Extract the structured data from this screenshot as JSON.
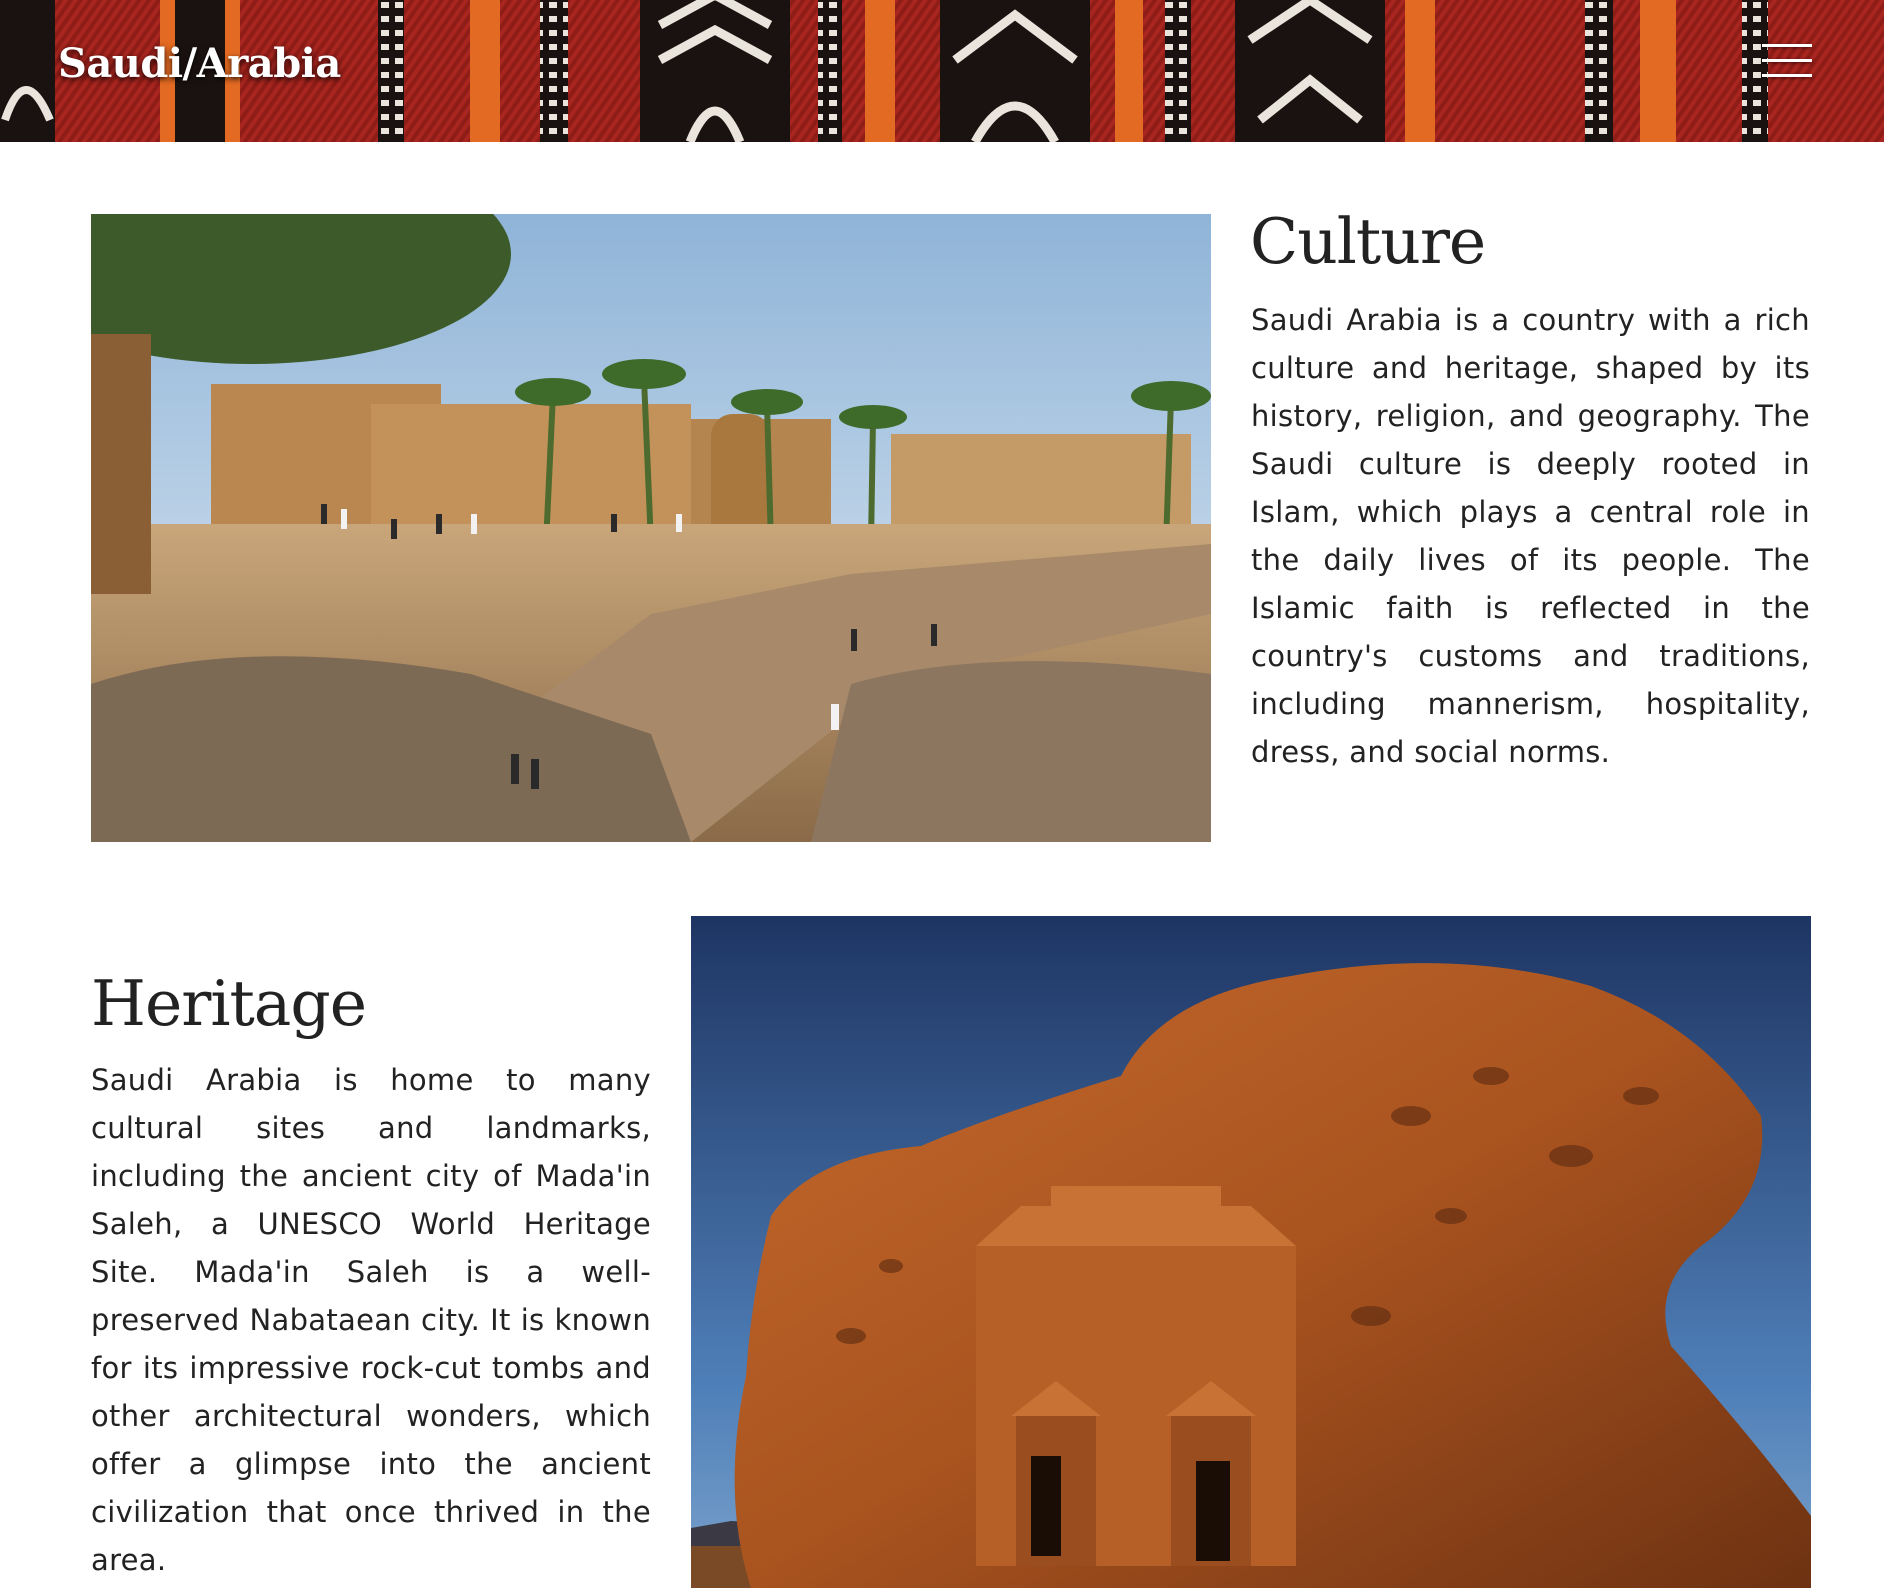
{
  "header": {
    "logo": "Saudi/Arabia",
    "menu_icon": "hamburger-menu-icon",
    "banner_colors": [
      "#a8261f",
      "#1a1210",
      "#e36a22",
      "#eeeeee"
    ]
  },
  "sections": {
    "culture": {
      "title": "Culture",
      "image": "illustration of a historic mud-brick town square with palm trees and a stone path",
      "text": "Saudi Arabia is a country with a rich culture and heritage, shaped by its history, religion, and geography. The Saudi culture is deeply rooted in Islam, which plays a central role in the daily lives of its people. The Islamic faith is reflected in the country's customs and traditions, including mannerism, hospitality, dress, and social norms."
    },
    "heritage": {
      "title": "Heritage",
      "image": "rock-cut Nabataean tomb at Mada'in Saleh under a deep blue sky",
      "text": "Saudi Arabia is home to many cultural sites and landmarks, including the ancient city of Mada'in Saleh, a UNESCO World Heritage Site. Mada'in Saleh is a well-preserved Nabataean city. It is known for its impressive rock-cut tombs and other architectural wonders, which offer a glimpse into the ancient civilization that once thrived in the area."
    }
  },
  "colors": {
    "text": "#222222",
    "background": "#ffffff",
    "banner_red": "#a8261f"
  }
}
